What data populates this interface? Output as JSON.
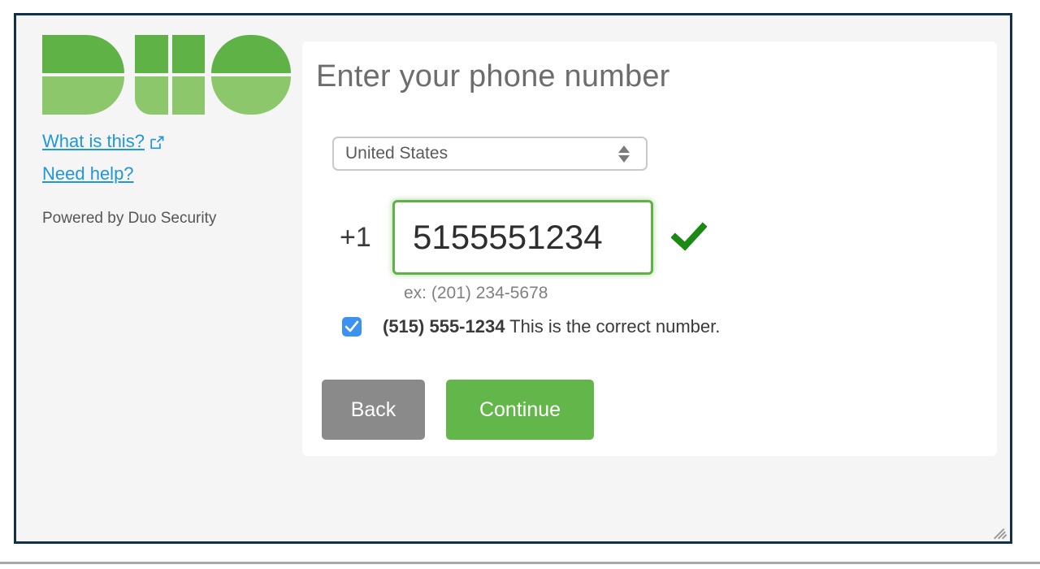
{
  "sidebar": {
    "logo_alt": "Duo",
    "links": [
      {
        "label": "What is this?",
        "icon": "external-link-icon",
        "has_icon": true
      },
      {
        "label": "Need help?",
        "has_icon": false
      }
    ],
    "powered_by": "Powered by Duo Security"
  },
  "card": {
    "title": "Enter your phone number",
    "country": {
      "selected": "United States",
      "icon": "stepper-arrows-icon"
    },
    "phone": {
      "country_code": "+1",
      "value": "5155551234",
      "placeholder": "",
      "hint": "ex: (201) 234-5678",
      "valid_icon": "green-checkmark-icon"
    },
    "confirm": {
      "checked": true,
      "number": "(515) 555-1234",
      "text": "This is the correct number."
    },
    "buttons": {
      "back": "Back",
      "continue": "Continue"
    }
  },
  "colors": {
    "duo_green_dark": "#5fb246",
    "duo_green_light": "#8cc76b",
    "link_blue": "#2196d9",
    "continue_green": "#63b74a",
    "back_gray": "#8a8a8a",
    "checkbox_blue": "#3c92f0",
    "valid_check_green": "#1a8a14",
    "frame_navy": "#123048"
  }
}
